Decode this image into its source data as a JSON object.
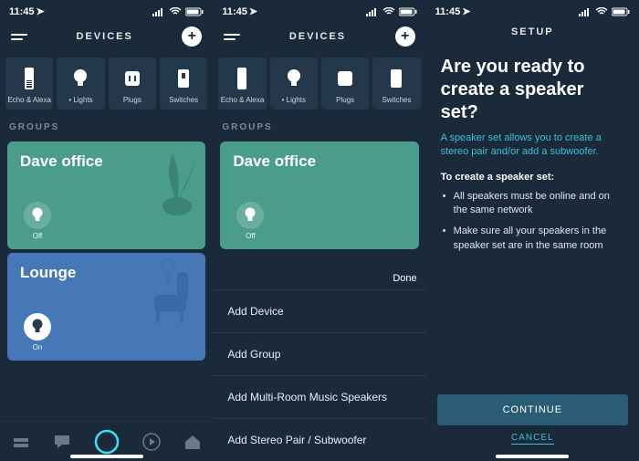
{
  "status": {
    "time": "11:45",
    "loc_glyph": "➤"
  },
  "screen1": {
    "title": "DEVICES",
    "devices": [
      {
        "label": "Echo & Alexa"
      },
      {
        "label": "• Lights"
      },
      {
        "label": "Plugs"
      },
      {
        "label": "Switches"
      }
    ],
    "groups_label": "GROUPS",
    "groups": [
      {
        "name": "Dave office",
        "state": "Off",
        "on": false
      },
      {
        "name": "Lounge",
        "state": "On",
        "on": true
      }
    ]
  },
  "screen2": {
    "done": "Done",
    "menu": [
      "Add Device",
      "Add Group",
      "Add Multi-Room Music Speakers",
      "Add Stereo Pair / Subwoofer"
    ]
  },
  "screen3": {
    "title": "SETUP",
    "heading": "Are you ready to create a speaker set?",
    "sub": "A speaker set allows you to create a stereo pair and/or add a subwoofer.",
    "list_title": "To create a speaker set:",
    "items": [
      "All speakers must be online and on the same network",
      "Make sure all your speakers in the speaker set are in the same room"
    ],
    "continue": "CONTINUE",
    "cancel": "CANCEL"
  }
}
